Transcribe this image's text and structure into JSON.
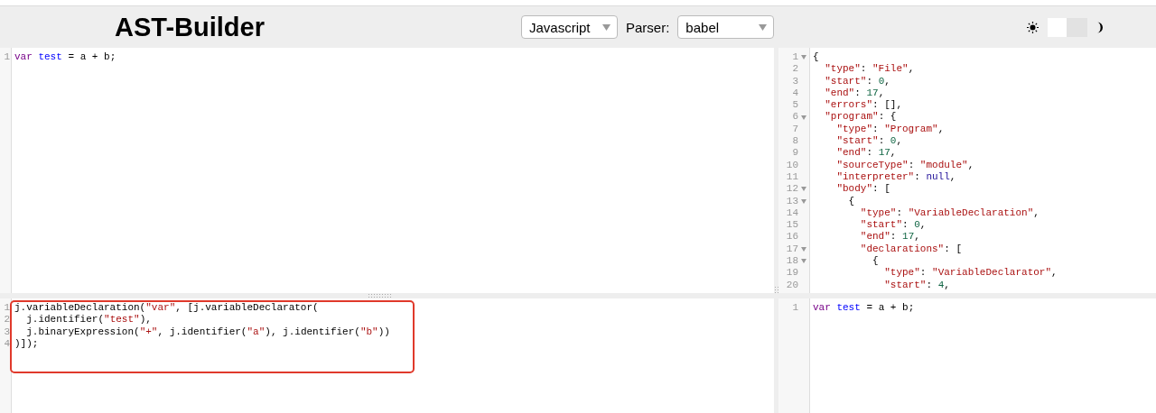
{
  "header": {
    "title": "AST-Builder",
    "language": "Javascript",
    "parser_label": "Parser:",
    "parser": "babel",
    "dark_mode": false
  },
  "source_editor": {
    "highlighted": false,
    "lines": [
      {
        "n": "1",
        "fold": false,
        "tokens": [
          {
            "text": "var",
            "kind": "keyword"
          },
          {
            "text": " test",
            "kind": "def"
          },
          {
            "text": " = a + b;",
            "kind": "plain"
          }
        ]
      }
    ]
  },
  "builder_editor": {
    "highlighted": true,
    "lines": [
      {
        "n": "1",
        "fold": false,
        "tokens": [
          {
            "text": "j.variableDeclaration(",
            "kind": "plain"
          },
          {
            "text": "\"var\"",
            "kind": "string"
          },
          {
            "text": ", [j.variableDeclarator(",
            "kind": "plain"
          }
        ]
      },
      {
        "n": "2",
        "fold": false,
        "tokens": [
          {
            "text": "  j.identifier(",
            "kind": "plain"
          },
          {
            "text": "\"test\"",
            "kind": "string"
          },
          {
            "text": "),",
            "kind": "plain"
          }
        ]
      },
      {
        "n": "3",
        "fold": false,
        "tokens": [
          {
            "text": "  j.binaryExpression(",
            "kind": "plain"
          },
          {
            "text": "\"+\"",
            "kind": "string"
          },
          {
            "text": ", j.identifier(",
            "kind": "plain"
          },
          {
            "text": "\"a\"",
            "kind": "string"
          },
          {
            "text": "), j.identifier(",
            "kind": "plain"
          },
          {
            "text": "\"b\"",
            "kind": "string"
          },
          {
            "text": "))",
            "kind": "plain"
          }
        ]
      },
      {
        "n": "4",
        "fold": false,
        "tokens": [
          {
            "text": ")]);",
            "kind": "plain"
          }
        ]
      }
    ]
  },
  "ast_view": {
    "highlighted": false,
    "lines": [
      {
        "n": "1",
        "fold": true,
        "tokens": [
          {
            "text": "{",
            "kind": "plain"
          }
        ]
      },
      {
        "n": "2",
        "fold": false,
        "tokens": [
          {
            "text": "  \"type\"",
            "kind": "string"
          },
          {
            "text": ": ",
            "kind": "plain"
          },
          {
            "text": "\"File\"",
            "kind": "string"
          },
          {
            "text": ",",
            "kind": "plain"
          }
        ]
      },
      {
        "n": "3",
        "fold": false,
        "tokens": [
          {
            "text": "  \"start\"",
            "kind": "string"
          },
          {
            "text": ": ",
            "kind": "plain"
          },
          {
            "text": "0",
            "kind": "number"
          },
          {
            "text": ",",
            "kind": "plain"
          }
        ]
      },
      {
        "n": "4",
        "fold": false,
        "tokens": [
          {
            "text": "  \"end\"",
            "kind": "string"
          },
          {
            "text": ": ",
            "kind": "plain"
          },
          {
            "text": "17",
            "kind": "number"
          },
          {
            "text": ",",
            "kind": "plain"
          }
        ]
      },
      {
        "n": "5",
        "fold": false,
        "tokens": [
          {
            "text": "  \"errors\"",
            "kind": "string"
          },
          {
            "text": ": [],",
            "kind": "plain"
          }
        ]
      },
      {
        "n": "6",
        "fold": true,
        "tokens": [
          {
            "text": "  \"program\"",
            "kind": "string"
          },
          {
            "text": ": {",
            "kind": "plain"
          }
        ]
      },
      {
        "n": "7",
        "fold": false,
        "tokens": [
          {
            "text": "    \"type\"",
            "kind": "string"
          },
          {
            "text": ": ",
            "kind": "plain"
          },
          {
            "text": "\"Program\"",
            "kind": "string"
          },
          {
            "text": ",",
            "kind": "plain"
          }
        ]
      },
      {
        "n": "8",
        "fold": false,
        "tokens": [
          {
            "text": "    \"start\"",
            "kind": "string"
          },
          {
            "text": ": ",
            "kind": "plain"
          },
          {
            "text": "0",
            "kind": "number"
          },
          {
            "text": ",",
            "kind": "plain"
          }
        ]
      },
      {
        "n": "9",
        "fold": false,
        "tokens": [
          {
            "text": "    \"end\"",
            "kind": "string"
          },
          {
            "text": ": ",
            "kind": "plain"
          },
          {
            "text": "17",
            "kind": "number"
          },
          {
            "text": ",",
            "kind": "plain"
          }
        ]
      },
      {
        "n": "10",
        "fold": false,
        "tokens": [
          {
            "text": "    \"sourceType\"",
            "kind": "string"
          },
          {
            "text": ": ",
            "kind": "plain"
          },
          {
            "text": "\"module\"",
            "kind": "string"
          },
          {
            "text": ",",
            "kind": "plain"
          }
        ]
      },
      {
        "n": "11",
        "fold": false,
        "tokens": [
          {
            "text": "    \"interpreter\"",
            "kind": "string"
          },
          {
            "text": ": ",
            "kind": "plain"
          },
          {
            "text": "null",
            "kind": "atom"
          },
          {
            "text": ",",
            "kind": "plain"
          }
        ]
      },
      {
        "n": "12",
        "fold": true,
        "tokens": [
          {
            "text": "    \"body\"",
            "kind": "string"
          },
          {
            "text": ": [",
            "kind": "plain"
          }
        ]
      },
      {
        "n": "13",
        "fold": true,
        "tokens": [
          {
            "text": "      {",
            "kind": "plain"
          }
        ]
      },
      {
        "n": "14",
        "fold": false,
        "tokens": [
          {
            "text": "        \"type\"",
            "kind": "string"
          },
          {
            "text": ": ",
            "kind": "plain"
          },
          {
            "text": "\"VariableDeclaration\"",
            "kind": "string"
          },
          {
            "text": ",",
            "kind": "plain"
          }
        ]
      },
      {
        "n": "15",
        "fold": false,
        "tokens": [
          {
            "text": "        \"start\"",
            "kind": "string"
          },
          {
            "text": ": ",
            "kind": "plain"
          },
          {
            "text": "0",
            "kind": "number"
          },
          {
            "text": ",",
            "kind": "plain"
          }
        ]
      },
      {
        "n": "16",
        "fold": false,
        "tokens": [
          {
            "text": "        \"end\"",
            "kind": "string"
          },
          {
            "text": ": ",
            "kind": "plain"
          },
          {
            "text": "17",
            "kind": "number"
          },
          {
            "text": ",",
            "kind": "plain"
          }
        ]
      },
      {
        "n": "17",
        "fold": true,
        "tokens": [
          {
            "text": "        \"declarations\"",
            "kind": "string"
          },
          {
            "text": ": [",
            "kind": "plain"
          }
        ]
      },
      {
        "n": "18",
        "fold": true,
        "tokens": [
          {
            "text": "          {",
            "kind": "plain"
          }
        ]
      },
      {
        "n": "19",
        "fold": false,
        "tokens": [
          {
            "text": "            \"type\"",
            "kind": "string"
          },
          {
            "text": ": ",
            "kind": "plain"
          },
          {
            "text": "\"VariableDeclarator\"",
            "kind": "string"
          },
          {
            "text": ",",
            "kind": "plain"
          }
        ]
      },
      {
        "n": "20",
        "fold": false,
        "tokens": [
          {
            "text": "            \"start\"",
            "kind": "string"
          },
          {
            "text": ": ",
            "kind": "plain"
          },
          {
            "text": "4",
            "kind": "number"
          },
          {
            "text": ",",
            "kind": "plain"
          }
        ]
      }
    ]
  },
  "output_view": {
    "highlighted": false,
    "lines": [
      {
        "n": "1",
        "fold": false,
        "tokens": [
          {
            "text": "var",
            "kind": "keyword"
          },
          {
            "text": " test",
            "kind": "def"
          },
          {
            "text": " = a + b;",
            "kind": "plain"
          }
        ]
      }
    ]
  }
}
